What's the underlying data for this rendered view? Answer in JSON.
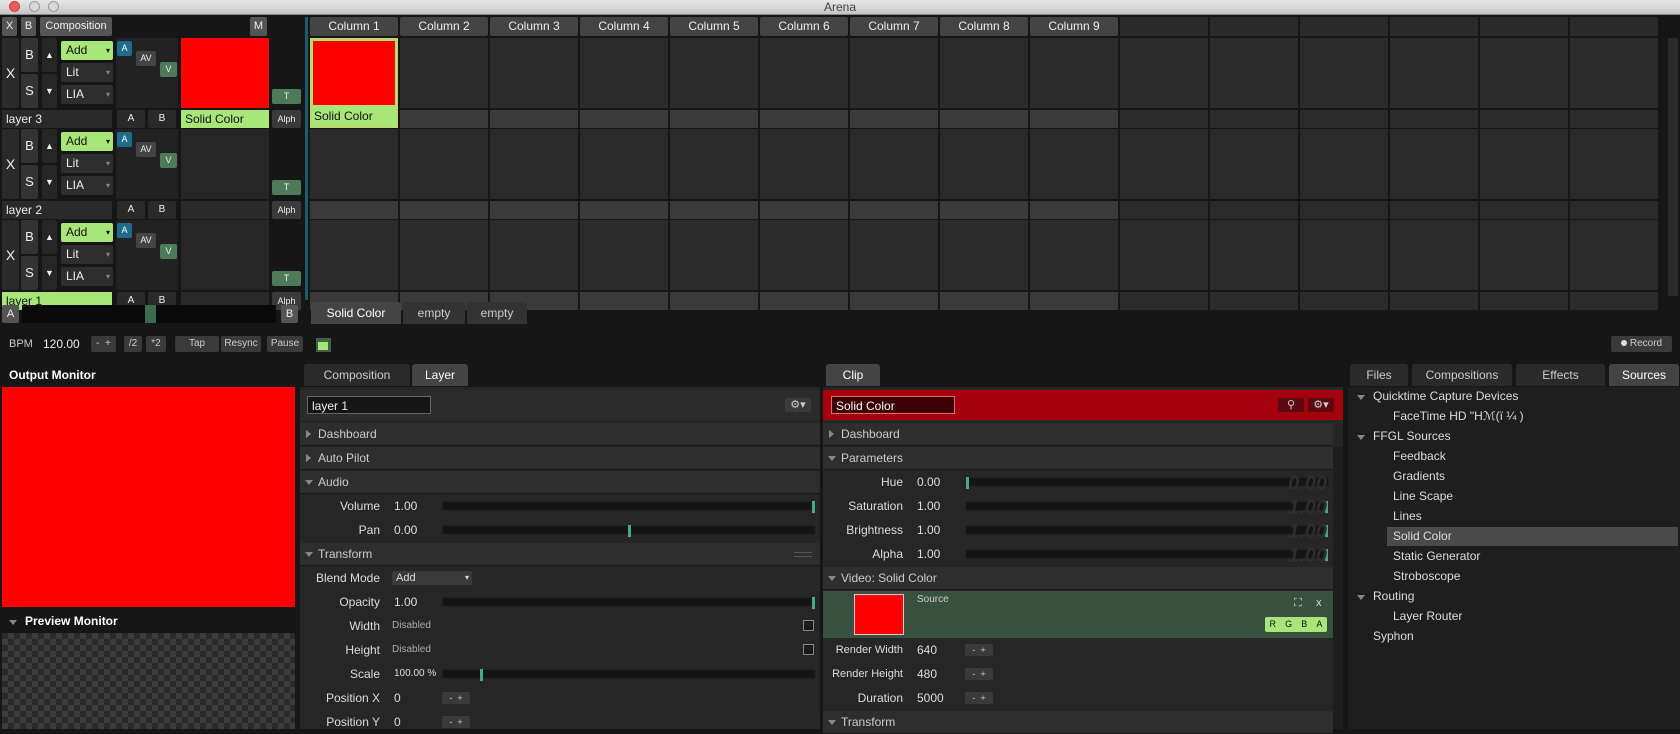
{
  "window": {
    "title": "Arena"
  },
  "top_bar": {
    "x": "X",
    "b": "B",
    "composition": "Composition",
    "m": "M"
  },
  "columns": [
    "Column 1",
    "Column 2",
    "Column 3",
    "Column 4",
    "Column 5",
    "Column 6",
    "Column 7",
    "Column 8",
    "Column 9"
  ],
  "layers": [
    {
      "name": "layer 3",
      "blend": "Add",
      "lit": "Lit",
      "lia": "LIA",
      "clip_label": "Solid Color",
      "col1_label": "Solid Color",
      "x": "X",
      "b": "B",
      "s": "S",
      "a": "A",
      "av": "AV",
      "v": "V",
      "t": "T",
      "alph": "Alph",
      "ab_a": "A",
      "ab_b": "B"
    },
    {
      "name": "layer 2",
      "blend": "Add",
      "lit": "Lit",
      "lia": "LIA",
      "x": "X",
      "b": "B",
      "s": "S",
      "a": "A",
      "av": "AV",
      "v": "V",
      "t": "T",
      "alph": "Alph",
      "ab_a": "A",
      "ab_b": "B"
    },
    {
      "name": "layer 1",
      "blend": "Add",
      "lit": "Lit",
      "lia": "LIA",
      "x": "X",
      "b": "B",
      "s": "S",
      "a": "A",
      "av": "AV",
      "v": "V",
      "t": "T",
      "alph": "Alph",
      "ab_a": "A",
      "ab_b": "B"
    }
  ],
  "crossfader": {
    "a": "A",
    "b": "B"
  },
  "deck_tabs": [
    "Solid Color",
    "empty",
    "empty"
  ],
  "transport": {
    "bpm_label": "BPM",
    "bpm_value": "120.00",
    "minus": "-",
    "plus": "+",
    "half": "/2",
    "double": "*2",
    "tap": "Tap",
    "resync": "Resync",
    "pause": "Pause",
    "record": "Record"
  },
  "output_monitor": {
    "title": "Output Monitor",
    "preview_title": "Preview Monitor"
  },
  "layer_panel": {
    "tabs": [
      "Composition",
      "Layer"
    ],
    "name_value": "layer 1",
    "sections": {
      "dashboard": "Dashboard",
      "autopilot": "Auto Pilot",
      "audio": "Audio",
      "transform": "Transform"
    },
    "volume": {
      "label": "Volume",
      "value": "1.00",
      "level": 1.0
    },
    "pan": {
      "label": "Pan",
      "value": "0.00",
      "level": 0.5
    },
    "blend_mode": {
      "label": "Blend Mode",
      "value": "Add"
    },
    "opacity": {
      "label": "Opacity",
      "value": "1.00",
      "level": 1.0
    },
    "width": {
      "label": "Width",
      "value": "Disabled"
    },
    "height": {
      "label": "Height",
      "value": "Disabled"
    },
    "scale": {
      "label": "Scale",
      "value": "100.00 %",
      "level": 0.1
    },
    "pos_x": {
      "label": "Position X",
      "value": "0"
    },
    "pos_y": {
      "label": "Position Y",
      "value": "0"
    },
    "minus": "-",
    "plus": "+"
  },
  "clip_panel": {
    "tab": "Clip",
    "name_value": "Solid Color",
    "sections": {
      "dashboard": "Dashboard",
      "parameters": "Parameters",
      "video": "Video: Solid Color",
      "transform": "Transform"
    },
    "hue": {
      "label": "Hue",
      "value": "0.00",
      "ghost": "0.00",
      "level": 0.0
    },
    "saturation": {
      "label": "Saturation",
      "value": "1.00",
      "ghost": "1.00",
      "level": 1.0
    },
    "brightness": {
      "label": "Brightness",
      "value": "1.00",
      "ghost": "1.00",
      "level": 1.0
    },
    "alpha": {
      "label": "Alpha",
      "value": "1.00",
      "ghost": "1.00",
      "level": 1.0
    },
    "source_label": "Source",
    "rgba": [
      "R",
      "G",
      "B",
      "A"
    ],
    "close": "x",
    "render_width": {
      "label": "Render Width",
      "value": "640"
    },
    "render_height": {
      "label": "Render Height",
      "value": "480"
    },
    "duration": {
      "label": "Duration",
      "value": "5000"
    },
    "minus": "-",
    "plus": "+"
  },
  "sources_panel": {
    "tabs": [
      "Files",
      "Compositions",
      "Effects",
      "Sources"
    ],
    "tree": [
      {
        "label": "Quicktime Capture Devices",
        "level": 0,
        "expanded": true
      },
      {
        "label": "FaceTime HD  \"Hℳ(ï ¼  )",
        "level": 1
      },
      {
        "label": "FFGL Sources",
        "level": 0,
        "expanded": true
      },
      {
        "label": "Feedback",
        "level": 1
      },
      {
        "label": "Gradients",
        "level": 1
      },
      {
        "label": "Line Scape",
        "level": 1
      },
      {
        "label": "Lines",
        "level": 1
      },
      {
        "label": "Solid Color",
        "level": 1,
        "selected": true
      },
      {
        "label": "Static Generator",
        "level": 1
      },
      {
        "label": "Stroboscope",
        "level": 1
      },
      {
        "label": "Routing",
        "level": 0,
        "expanded": true
      },
      {
        "label": "Layer Router",
        "level": 1
      },
      {
        "label": "Syphon",
        "level": 0
      }
    ]
  },
  "colors": {
    "clip_red": "#ff0000",
    "accent_green": "#a8e67a",
    "teal": "#1c6c8a",
    "clip_header_red": "#a5000d"
  }
}
